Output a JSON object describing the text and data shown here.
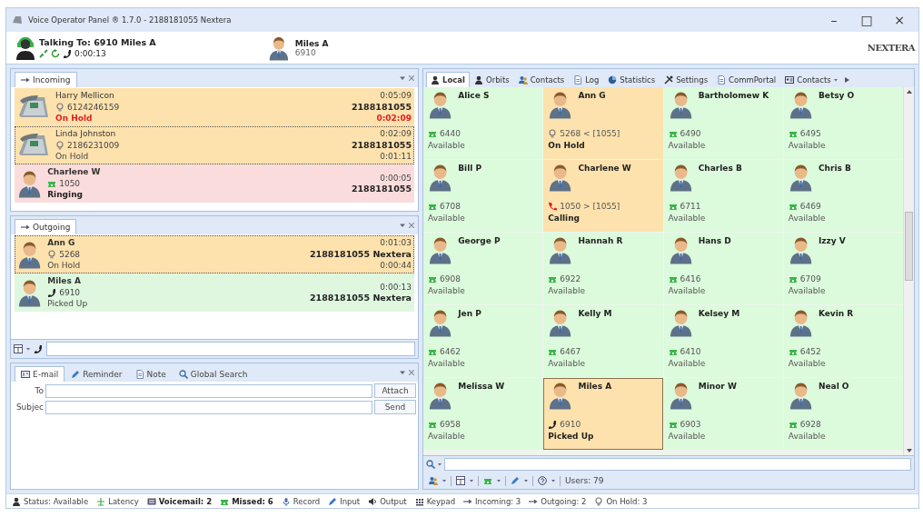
{
  "window": {
    "title": "Voice Operator Panel ® 1.7.0 - 2188181055 Nextera",
    "controls": [
      "–",
      "□",
      "×"
    ]
  },
  "header": {
    "talking_to": "Talking To: 6910 Miles A",
    "timer": "0:00:13",
    "contact": {
      "name": "Miles A",
      "extension": "6910"
    },
    "logo": "NEXTERA"
  },
  "incoming": {
    "tab": "Incoming",
    "calls": [
      {
        "kind": "parked",
        "color": "#fde2ae",
        "name": "Harry Mellicon",
        "number": "6124246159",
        "status": "On Hold",
        "overdue": true,
        "duration": "0:05:09",
        "line": "2188181055",
        "hold_time": "0:02:09",
        "selected": false
      },
      {
        "kind": "parked",
        "color": "#fde2ae",
        "name": "Linda Johnston",
        "number": "2186231009",
        "status": "On Hold",
        "overdue": false,
        "duration": "0:02:09",
        "line": "2188181055",
        "hold_time": "0:01:11",
        "selected": true
      },
      {
        "kind": "ringing",
        "color": "#fbdcdc",
        "name": "Charlene W",
        "number": "1050",
        "status": "Ringing",
        "overdue": false,
        "duration": "0:00:05",
        "line": "2188181055",
        "selected": false
      }
    ]
  },
  "outgoing": {
    "tab": "Outgoing",
    "calls": [
      {
        "kind": "held",
        "color": "#fde2ae",
        "name": "Ann G",
        "number": "5268",
        "status": "On Hold",
        "overdue": false,
        "duration": "0:01:03",
        "line": "2188181055 Nextera",
        "hold_time": "0:00:44",
        "selected": true
      },
      {
        "kind": "connected",
        "color": "#dff7df",
        "name": "Miles A",
        "number": "6910",
        "status": "Picked Up",
        "overdue": false,
        "duration": "0:00:13",
        "line": "2188181055 Nextera",
        "selected": false
      }
    ]
  },
  "compose": {
    "tabs": [
      {
        "label": "E-mail",
        "kind": "email",
        "selected": true
      },
      {
        "label": "Reminder",
        "kind": "pen",
        "selected": false
      },
      {
        "label": "Note",
        "kind": "note",
        "selected": false
      },
      {
        "label": "Global Search",
        "kind": "search",
        "selected": false
      }
    ],
    "fields": [
      {
        "label": "To",
        "button": "Attach"
      },
      {
        "label": "Subjec",
        "button": "Send"
      }
    ]
  },
  "directory": {
    "tabs": [
      {
        "label": "Local",
        "kind": "person",
        "selected": true,
        "dropdown": false
      },
      {
        "label": "Orbits",
        "kind": "person",
        "selected": false,
        "dropdown": false
      },
      {
        "label": "Contacts",
        "kind": "people",
        "selected": false,
        "dropdown": false
      },
      {
        "label": "Log",
        "kind": "note",
        "selected": false,
        "dropdown": false
      },
      {
        "label": "Statistics",
        "kind": "pie",
        "selected": false,
        "dropdown": false
      },
      {
        "label": "Settings",
        "kind": "tools",
        "selected": false,
        "dropdown": false
      },
      {
        "label": "CommPortal",
        "kind": "note",
        "selected": false,
        "dropdown": false
      },
      {
        "label": "Contacts",
        "kind": "card",
        "selected": false,
        "dropdown": true
      }
    ],
    "contacts": [
      {
        "name": "Alice S",
        "kind": "available",
        "color": "#dcfadc",
        "extension": "6440",
        "status": "Available",
        "selected": false
      },
      {
        "name": "Ann G",
        "kind": "held",
        "color": "#fde2ae",
        "extension": "5268 < [1055]",
        "status": "On Hold",
        "selected": false
      },
      {
        "name": "Bartholomew K",
        "kind": "available",
        "color": "#dcfadc",
        "extension": "6490",
        "status": "Available",
        "selected": false
      },
      {
        "name": "Betsy O",
        "kind": "available",
        "color": "#dcfadc",
        "extension": "6495",
        "status": "Available",
        "selected": false
      },
      {
        "name": "Bill P",
        "kind": "available",
        "color": "#dcfadc",
        "extension": "6708",
        "status": "Available",
        "selected": false
      },
      {
        "name": "Charlene W",
        "kind": "calling",
        "color": "#fde2ae",
        "extension": "1050 > [1055]",
        "status": "Calling",
        "selected": false
      },
      {
        "name": "Charles B",
        "kind": "available",
        "color": "#dcfadc",
        "extension": "6711",
        "status": "Available",
        "selected": false
      },
      {
        "name": "Chris B",
        "kind": "available",
        "color": "#dcfadc",
        "extension": "6469",
        "status": "Available",
        "selected": false
      },
      {
        "name": "George P",
        "kind": "available",
        "color": "#dcfadc",
        "extension": "6908",
        "status": "Available",
        "selected": false
      },
      {
        "name": "Hannah R",
        "kind": "available",
        "color": "#dcfadc",
        "extension": "6922",
        "status": "Available",
        "selected": false
      },
      {
        "name": "Hans D",
        "kind": "available",
        "color": "#dcfadc",
        "extension": "6416",
        "status": "Available",
        "selected": false
      },
      {
        "name": "Izzy V",
        "kind": "available",
        "color": "#dcfadc",
        "extension": "6709",
        "status": "Available",
        "selected": false
      },
      {
        "name": "Jen P",
        "kind": "available",
        "color": "#dcfadc",
        "extension": "6462",
        "status": "Available",
        "selected": false
      },
      {
        "name": "Kelly M",
        "kind": "available",
        "color": "#dcfadc",
        "extension": "6467",
        "status": "Available",
        "selected": false
      },
      {
        "name": "Kelsey M",
        "kind": "available",
        "color": "#dcfadc",
        "extension": "6410",
        "status": "Available",
        "selected": false
      },
      {
        "name": "Kevin R",
        "kind": "available",
        "color": "#dcfadc",
        "extension": "6452",
        "status": "Available",
        "selected": false
      },
      {
        "name": "Melissa W",
        "kind": "available",
        "color": "#dcfadc",
        "extension": "6958",
        "status": "Available",
        "selected": false
      },
      {
        "name": "Miles A",
        "kind": "connected",
        "color": "#fde2ae",
        "extension": "6910",
        "status": "Picked Up",
        "selected": true
      },
      {
        "name": "Minor W",
        "kind": "available",
        "color": "#dcfadc",
        "extension": "6903",
        "status": "Available",
        "selected": false
      },
      {
        "name": "Neal O",
        "kind": "available",
        "color": "#dcfadc",
        "extension": "6928",
        "status": "Available",
        "selected": false
      }
    ],
    "users": "Users: 79"
  },
  "status_bar": [
    {
      "kind": "person",
      "text": "Status: Available",
      "bold": false
    },
    {
      "kind": "latency",
      "text": "Latency",
      "bold": false
    },
    {
      "kind": "voicemail",
      "text": "Voicemail: 2",
      "bold": true
    },
    {
      "kind": "desk",
      "text": "Missed: 6",
      "bold": true
    },
    {
      "kind": "mic",
      "text": "Record",
      "bold": false
    },
    {
      "kind": "pen",
      "text": "Input",
      "bold": false
    },
    {
      "kind": "speaker",
      "text": "Output",
      "bold": false
    },
    {
      "kind": "keypad",
      "text": "Keypad",
      "bold": false
    },
    {
      "kind": "arrow",
      "text": "Incoming: 3",
      "bold": false
    },
    {
      "kind": "arrow",
      "text": "Outgoing: 2",
      "bold": false
    },
    {
      "kind": "hold",
      "text": "On Hold: 3",
      "bold": false
    }
  ]
}
